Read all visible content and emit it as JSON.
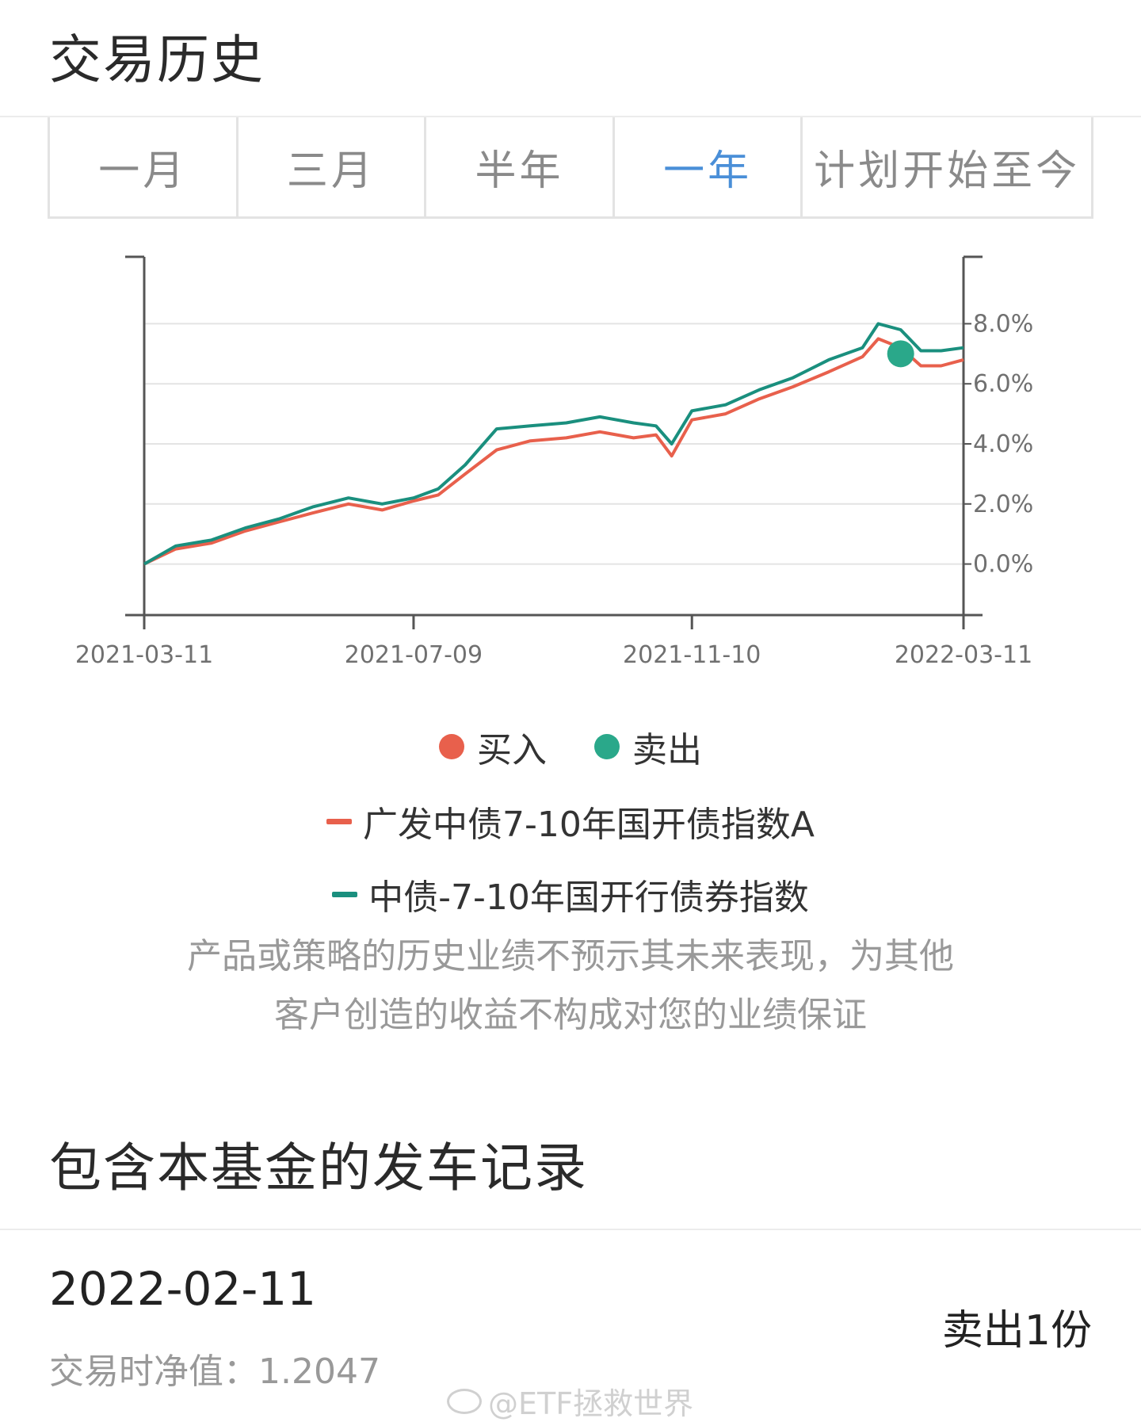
{
  "section1": {
    "title": "交易历史"
  },
  "tabs": [
    {
      "label": "一月",
      "active": false
    },
    {
      "label": "三月",
      "active": false
    },
    {
      "label": "半年",
      "active": false
    },
    {
      "label": "一年",
      "active": true
    },
    {
      "label": "计划开始至今",
      "active": false
    }
  ],
  "colors": {
    "active_tab": "#4a8fd8",
    "buy": "#e8604c",
    "sell": "#2aa88a",
    "series1": "#e8604c",
    "series2": "#1a8f7e"
  },
  "chart_data": {
    "type": "line",
    "x_ticks": [
      "2021-03-11",
      "2021-07-09",
      "2021-11-10",
      "2022-03-11"
    ],
    "y_ticks": [
      "0.0%",
      "2.0%",
      "4.0%",
      "6.0%",
      "8.0%"
    ],
    "ylim": [
      -1.7,
      9.7
    ],
    "y_axis_side": "right",
    "grid": true,
    "series": [
      {
        "name": "广发中债7-10年国开债指数A",
        "color": "#e8604c",
        "x": [
          "2021-03-11",
          "2021-03-25",
          "2021-04-10",
          "2021-04-25",
          "2021-05-10",
          "2021-05-25",
          "2021-06-10",
          "2021-06-25",
          "2021-07-09",
          "2021-07-20",
          "2021-08-01",
          "2021-08-15",
          "2021-08-30",
          "2021-09-15",
          "2021-09-30",
          "2021-10-15",
          "2021-10-25",
          "2021-11-01",
          "2021-11-10",
          "2021-11-25",
          "2021-12-10",
          "2021-12-25",
          "2022-01-10",
          "2022-01-25",
          "2022-02-01",
          "2022-02-11",
          "2022-02-20",
          "2022-03-01",
          "2022-03-11"
        ],
        "values": [
          0.0,
          0.5,
          0.7,
          1.1,
          1.4,
          1.7,
          2.0,
          1.8,
          2.1,
          2.3,
          3.0,
          3.8,
          4.1,
          4.2,
          4.4,
          4.2,
          4.3,
          3.6,
          4.8,
          5.0,
          5.5,
          5.9,
          6.4,
          6.9,
          7.5,
          7.2,
          6.6,
          6.6,
          6.8
        ]
      },
      {
        "name": "中债-7-10年国开行债券指数",
        "color": "#1a8f7e",
        "x": [
          "2021-03-11",
          "2021-03-25",
          "2021-04-10",
          "2021-04-25",
          "2021-05-10",
          "2021-05-25",
          "2021-06-10",
          "2021-06-25",
          "2021-07-09",
          "2021-07-20",
          "2021-08-01",
          "2021-08-15",
          "2021-08-30",
          "2021-09-15",
          "2021-09-30",
          "2021-10-15",
          "2021-10-25",
          "2021-11-01",
          "2021-11-10",
          "2021-11-25",
          "2021-12-10",
          "2021-12-25",
          "2022-01-10",
          "2022-01-25",
          "2022-02-01",
          "2022-02-11",
          "2022-02-20",
          "2022-03-01",
          "2022-03-11"
        ],
        "values": [
          0.0,
          0.6,
          0.8,
          1.2,
          1.5,
          1.9,
          2.2,
          2.0,
          2.2,
          2.5,
          3.3,
          4.5,
          4.6,
          4.7,
          4.9,
          4.7,
          4.6,
          4.0,
          5.1,
          5.3,
          5.8,
          6.2,
          6.8,
          7.2,
          8.0,
          7.8,
          7.1,
          7.1,
          7.2
        ]
      }
    ],
    "markers": [
      {
        "type": "sell",
        "x": "2022-02-11",
        "y": 7.0
      }
    ]
  },
  "legend": {
    "buy_label": "买入",
    "sell_label": "卖出",
    "series1_label": "广发中债7-10年国开债指数A",
    "series2_label": "中债-7-10年国开行债券指数"
  },
  "disclaimer": {
    "line1": "产品或策略的历史业绩不预示其未来表现，为其他",
    "line2": "客户创造的收益不构成对您的业绩保证"
  },
  "section2": {
    "title": "包含本基金的发车记录"
  },
  "record": {
    "date": "2022-02-11",
    "nav": "交易时净值：1.2047",
    "action": "卖出1份"
  },
  "watermark": "@ETF拯救世界"
}
